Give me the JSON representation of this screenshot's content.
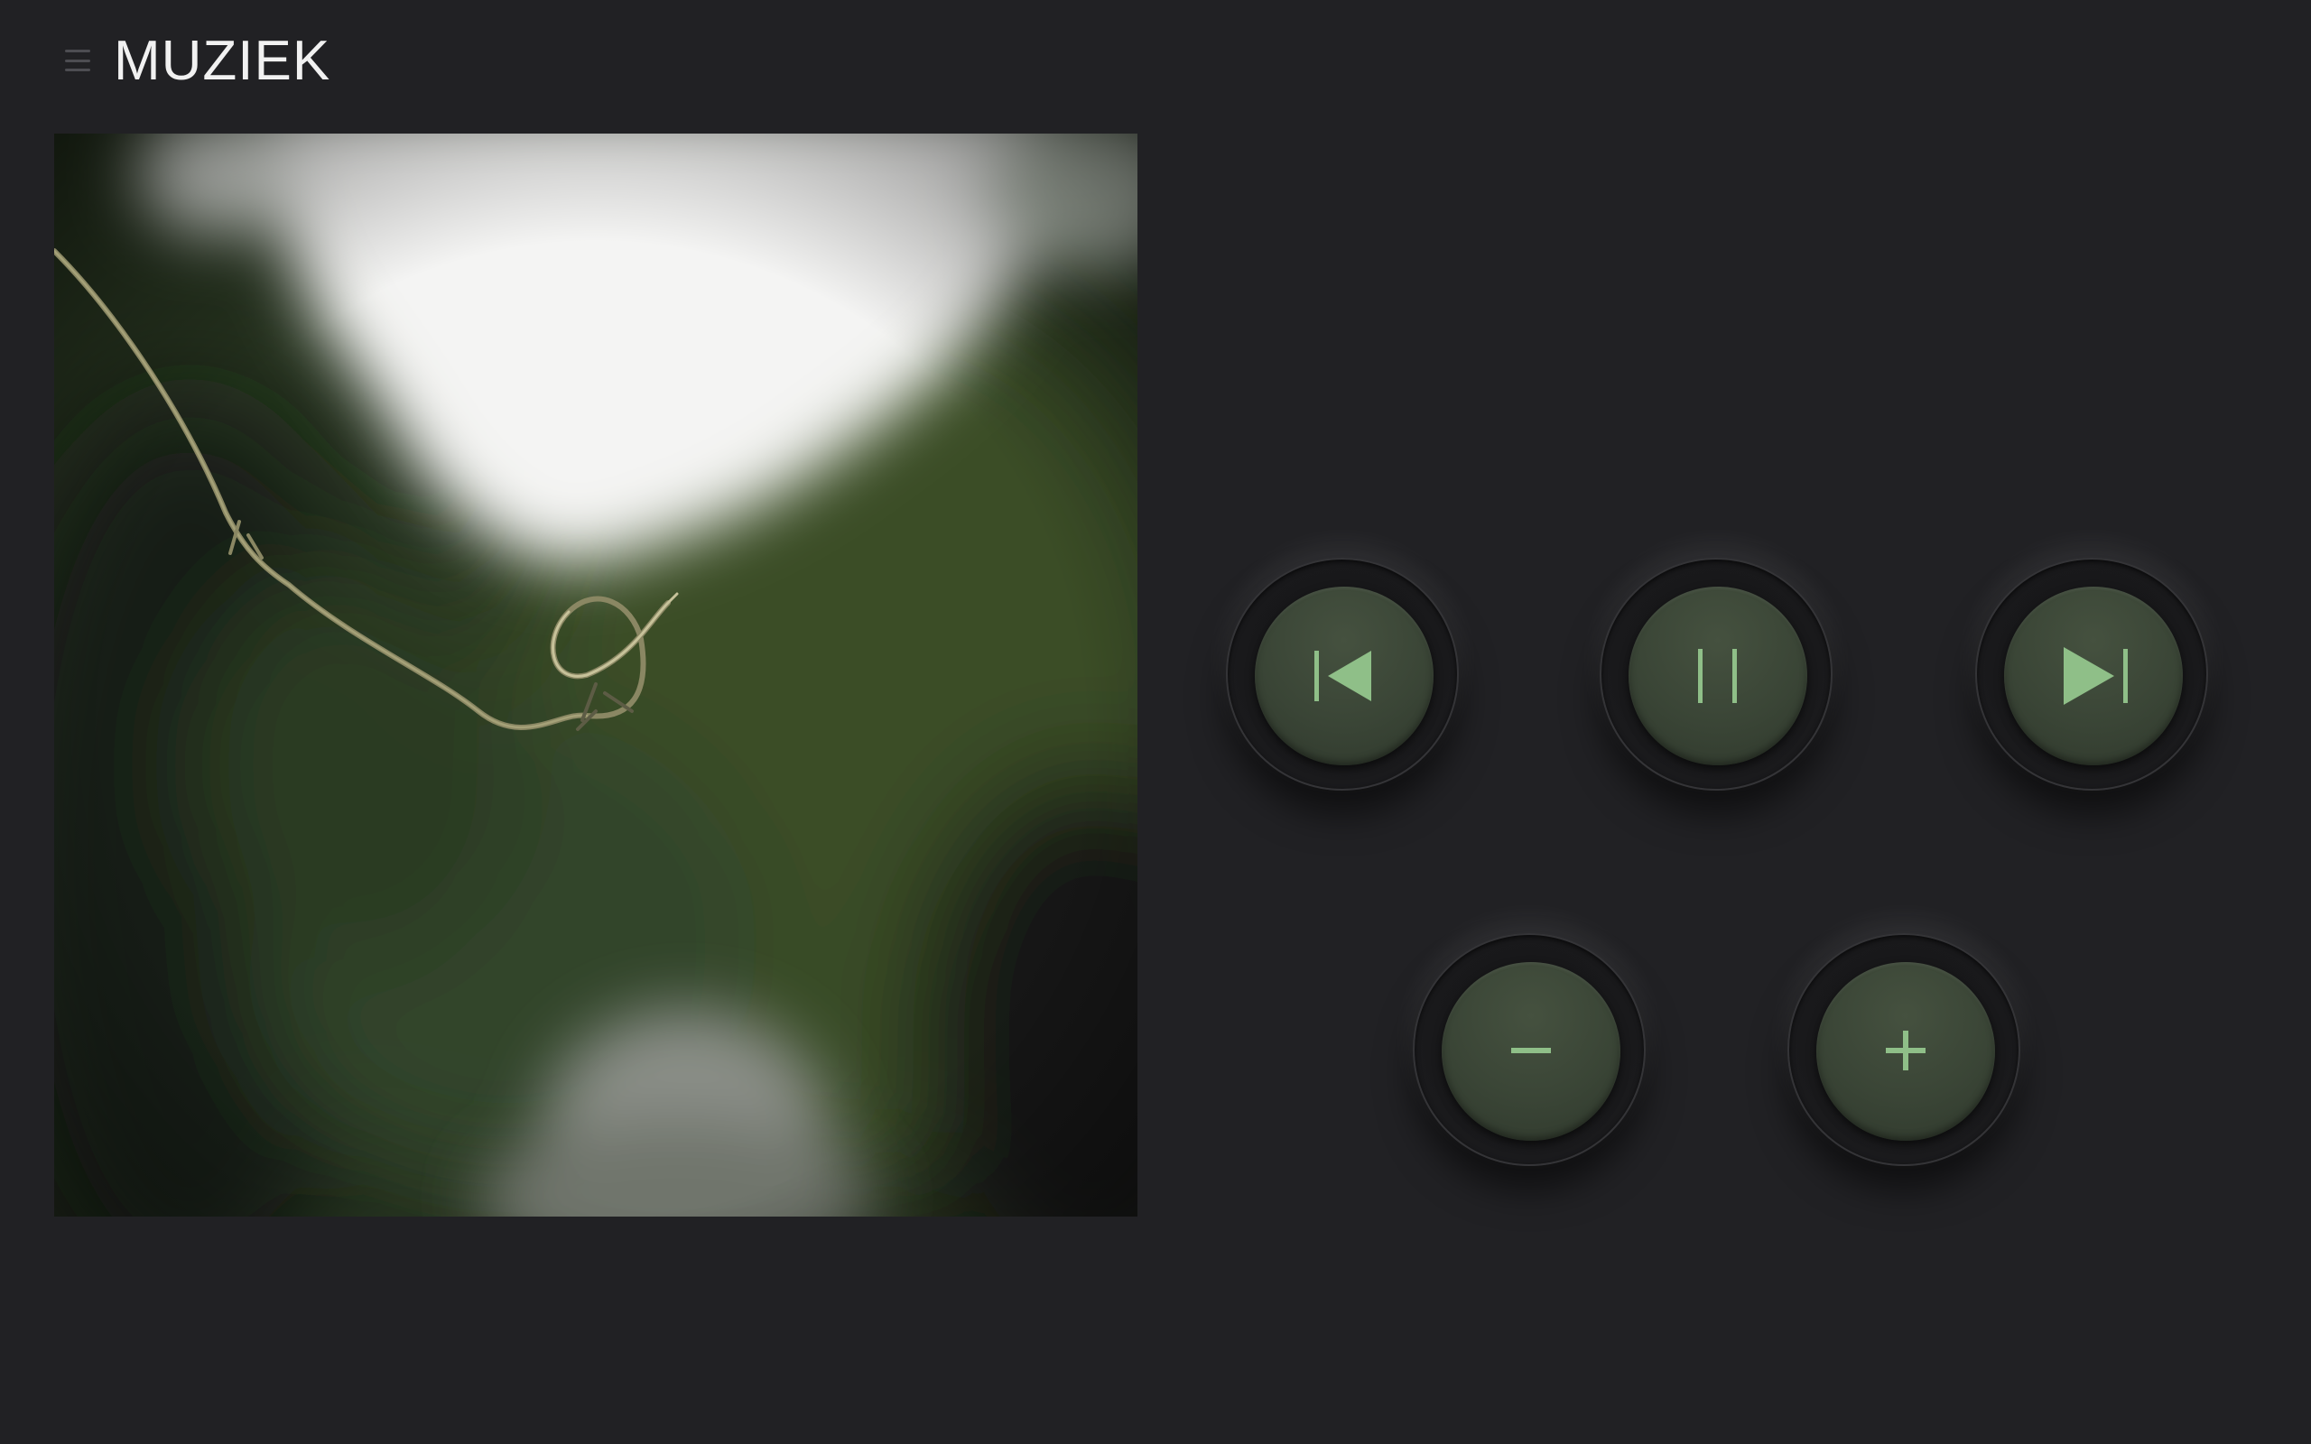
{
  "header": {
    "title": "MUZIEK",
    "menu_icon": "hamburger-menu-icon"
  },
  "album": {
    "image": "album-art-vine-tendril"
  },
  "controls": {
    "previous_icon": "skip-previous-icon",
    "pause_icon": "pause-icon",
    "next_icon": "skip-next-icon",
    "volume_down_icon": "minus-icon",
    "volume_up_icon": "plus-icon"
  },
  "colors": {
    "background": "#212124",
    "accent": "#8fbf88",
    "button_face": "#3a4536",
    "title_text": "#f1f1f1"
  }
}
